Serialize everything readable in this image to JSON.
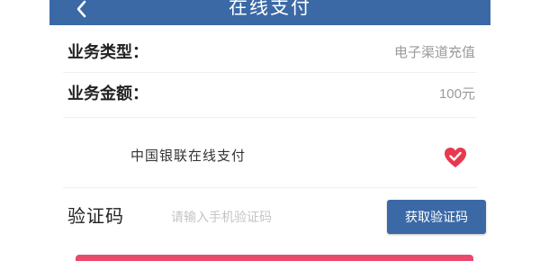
{
  "header": {
    "title": "在线支付",
    "back_icon": "chevron-left-icon"
  },
  "info": {
    "type_label": "业务类型：",
    "type_value": "电子渠道充值",
    "amount_label": "业务金额：",
    "amount_value": "100元"
  },
  "payment": {
    "option_label": "中国银联在线支付",
    "selected": true,
    "selected_icon": "check-circle-icon"
  },
  "verify": {
    "label": "验证码",
    "placeholder": "请输入手机验证码",
    "value": "",
    "button_label": "获取验证码"
  },
  "colors": {
    "header_bg": "#3b69a6",
    "button_bg": "#3b69a6",
    "accent_red": "#e9496a",
    "check_red": "#e8394e"
  }
}
